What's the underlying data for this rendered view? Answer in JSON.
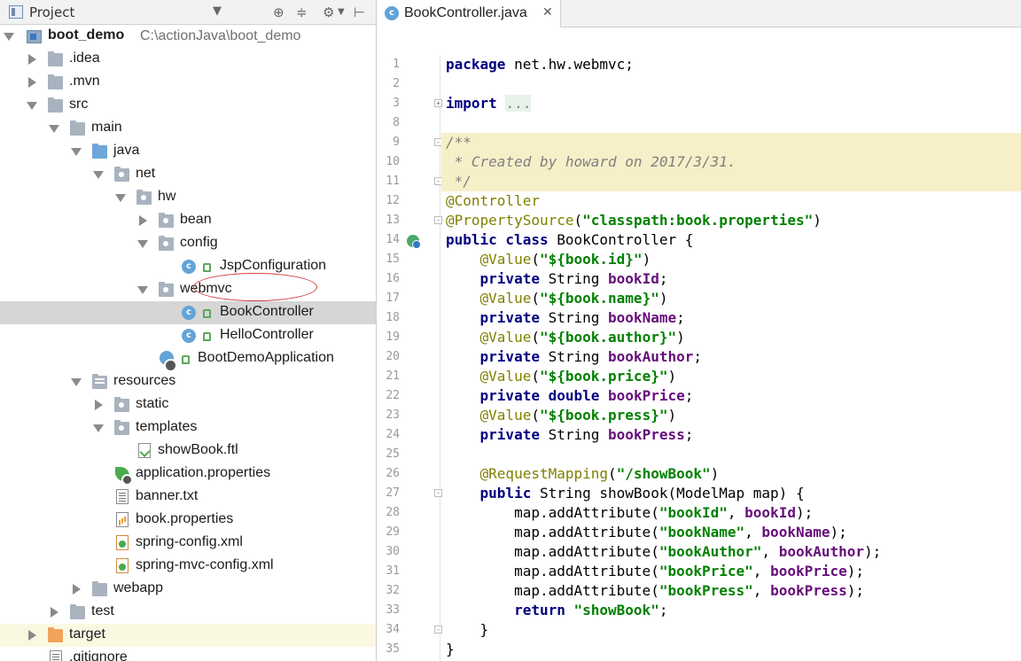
{
  "project_panel": {
    "title": "Project",
    "dropdown_icon": "triangle-down-icon",
    "toolbar_icons": [
      "locate-icon",
      "collapse-icon",
      "gear-icon",
      "hide-icon"
    ]
  },
  "tree": {
    "root_name": "boot_demo",
    "root_path": "C:\\actionJava\\boot_demo",
    "items": [
      {
        "label": ".idea"
      },
      {
        "label": ".mvn"
      },
      {
        "label": "src"
      },
      {
        "label": "main"
      },
      {
        "label": "java"
      },
      {
        "label": "net"
      },
      {
        "label": "hw"
      },
      {
        "label": "bean"
      },
      {
        "label": "config"
      },
      {
        "label": "JspConfiguration"
      },
      {
        "label": "webmvc"
      },
      {
        "label": "BookController"
      },
      {
        "label": "HelloController"
      },
      {
        "label": "BootDemoApplication"
      },
      {
        "label": "resources"
      },
      {
        "label": "static"
      },
      {
        "label": "templates"
      },
      {
        "label": "showBook.ftl"
      },
      {
        "label": "application.properties"
      },
      {
        "label": "banner.txt"
      },
      {
        "label": "book.properties"
      },
      {
        "label": "spring-config.xml"
      },
      {
        "label": "spring-mvc-config.xml"
      },
      {
        "label": "webapp"
      },
      {
        "label": "test"
      },
      {
        "label": "target"
      },
      {
        "label": ".gitignore"
      }
    ]
  },
  "editor": {
    "tab": {
      "label": "BookController.java",
      "icon_letter": "c"
    },
    "lines": {
      "l1_kw": "package",
      "l1_rest": " net.hw.webmvc;",
      "l3_kw": "import",
      "l3_dots": "...",
      "l9": "/**",
      "l10": " * Created by howard on 2017/3/31.",
      "l11": " */",
      "l12": "@Controller",
      "l13_ann": "@PropertySource",
      "l13_open": "(",
      "l13_str": "\"classpath:book.properties\"",
      "l13_close": ")",
      "l14_kw": "public class",
      "l14_rest": " BookController {",
      "value_ann": "@Value",
      "private": "private",
      "double": "double",
      "string_type": " String ",
      "l15_str": "\"${book.id}\"",
      "l16_fld": "bookId",
      "l17_str": "\"${book.name}\"",
      "l18_fld": "bookName",
      "l19_str": "\"${book.author}\"",
      "l20_fld": "bookAuthor",
      "l21_str": "\"${book.price}\"",
      "l22_fld": "bookPrice",
      "l23_str": "\"${book.press}\"",
      "l24_fld": "bookPress",
      "l26_ann": "@RequestMapping",
      "l26_str": "\"/showBook\"",
      "l27_kw": "public",
      "l27_rest": " String showBook(ModelMap map) {",
      "add_call": "map.addAttribute(",
      "l28_str": "\"bookId\"",
      "l29_str": "\"bookName\"",
      "l30_str": "\"bookAuthor\"",
      "l31_str": "\"bookPrice\"",
      "l32_str": "\"bookPress\"",
      "l33_kw": "return",
      "l33_str": " \"showBook\"",
      "l34": "}",
      "l35": "}"
    },
    "line_numbers": [
      "1",
      "2",
      "3",
      "8",
      "9",
      "10",
      "11",
      "12",
      "13",
      "14",
      "15",
      "16",
      "17",
      "18",
      "19",
      "20",
      "21",
      "22",
      "23",
      "24",
      "25",
      "26",
      "27",
      "28",
      "29",
      "30",
      "31",
      "32",
      "33",
      "34",
      "35"
    ]
  }
}
